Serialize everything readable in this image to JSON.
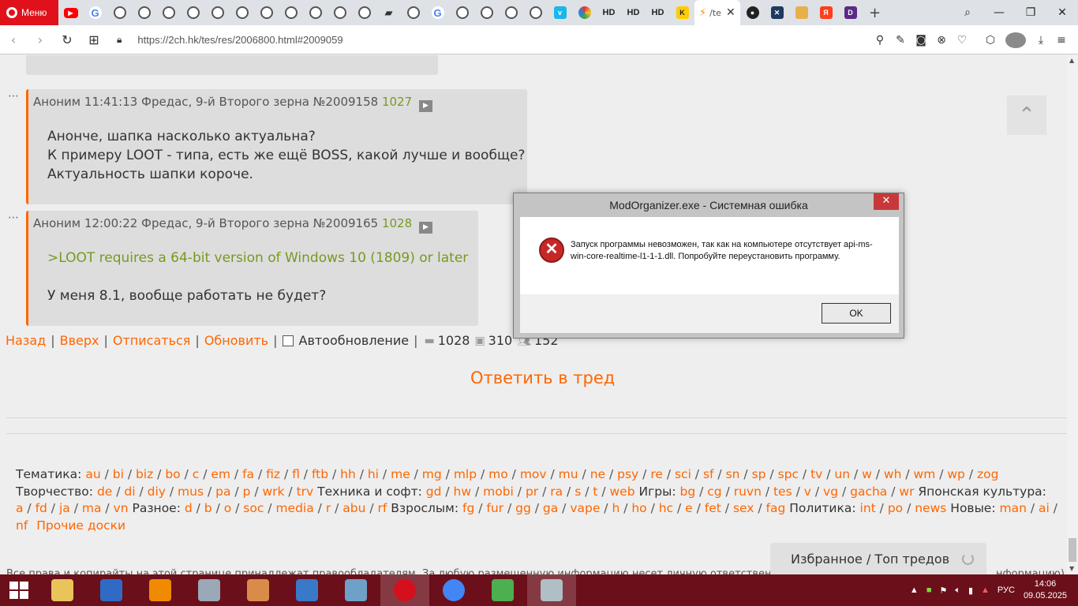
{
  "browser": {
    "menu_label": "Меню",
    "tab_icons": [
      "youtube-icon",
      "google-icon",
      "globe-icon",
      "globe-icon",
      "globe-icon",
      "globe-icon",
      "globe-icon",
      "globe-icon",
      "globe-icon",
      "globe-icon",
      "globe-icon",
      "globe-icon",
      "globe-icon",
      "car-icon",
      "globe-icon",
      "google-icon",
      "globe-icon",
      "globe-icon",
      "globe-icon",
      "globe-icon",
      "vimeo-icon",
      "colorful-icon",
      "hd-icon",
      "hd-icon",
      "hd-icon",
      "kg-icon"
    ],
    "hd_label": "HD",
    "active_tab_title": "/te",
    "url": "https://2ch.hk/tes/res/2006800.html#2009059"
  },
  "posts": [
    {
      "author": "Аноним",
      "time": "11:41:13 Фредас, 9-й Второго зерна",
      "id": "№2009158",
      "num": "1027",
      "lines": [
        "Анонче, шапка насколько актуальна?",
        "К примеру LOOT - типа, есть же ещё BOSS, какой лучше и вообще?",
        "Актуальность шапки короче."
      ]
    },
    {
      "author": "Аноним",
      "time": "12:00:22 Фредас, 9-й Второго зерна",
      "id": "№2009165",
      "num": "1028",
      "greentext": ">LOOT requires a 64-bit version of Windows 10 (1809) or later",
      "lines": [
        "У меня 8.1, вообще работать не будет?"
      ]
    }
  ],
  "thread_nav": {
    "back": "Назад",
    "up": "Вверх",
    "unsubscribe": "Отписаться",
    "refresh": "Обновить",
    "autoupdate": "Автообновление",
    "posts_count": "1028",
    "images_count": "310",
    "users_count": "152"
  },
  "reply_link": "Ответить в тред",
  "board_groups": [
    {
      "label": "Тематика:",
      "boards": [
        "au",
        "bi",
        "biz",
        "bo",
        "c",
        "em",
        "fa",
        "fiz",
        "fl",
        "ftb",
        "hh",
        "hi",
        "me",
        "mg",
        "mlp",
        "mo",
        "mov",
        "mu",
        "ne",
        "psy",
        "re",
        "sci",
        "sf",
        "sn",
        "sp",
        "spc",
        "tv",
        "un",
        "w",
        "wh",
        "wm",
        "wp",
        "zog"
      ]
    },
    {
      "label": "Творчество:",
      "boards": [
        "de",
        "di",
        "diy",
        "mus",
        "pa",
        "p",
        "wrk",
        "trv"
      ]
    },
    {
      "label": "Техника и софт:",
      "boards": [
        "gd",
        "hw",
        "mobi",
        "pr",
        "ra",
        "s",
        "t",
        "web"
      ]
    },
    {
      "label": "Игры:",
      "boards": [
        "bg",
        "cg",
        "ruvn",
        "tes",
        "v",
        "vg",
        "gacha",
        "wr"
      ]
    },
    {
      "label": "Японская культура:",
      "boards": [
        "a",
        "fd",
        "ja",
        "ma",
        "vn"
      ]
    },
    {
      "label": "Разное:",
      "boards": [
        "d",
        "b",
        "o",
        "soc",
        "media",
        "r",
        "abu",
        "rf"
      ]
    },
    {
      "label": "Взрослым:",
      "boards": [
        "fg",
        "fur",
        "gg",
        "ga",
        "vape",
        "h",
        "ho",
        "hc",
        "e",
        "fet",
        "sex",
        "fag"
      ]
    },
    {
      "label": "Политика:",
      "boards": [
        "int",
        "po",
        "news"
      ]
    },
    {
      "label": "Новые:",
      "boards": [
        "man",
        "ai",
        "nf"
      ]
    }
  ],
  "other_boards": "Прочие доски",
  "favorites": "Избранное / Топ тредов",
  "footer_text": "Все права и копирайты на этой странице принадлежат правообладателям. За любую размещенную информацию несет личную ответственность",
  "footer_text_tail": "нформацию)",
  "dialog": {
    "title": "ModOrganizer.exe - Системная ошибка",
    "message": "Запуск программы невозможен, так как на компьютере отсутствует api-ms-win-core-realtime-l1-1-1.dll. Попробуйте переустановить программу.",
    "ok": "OK",
    "close": "✕"
  },
  "taskbar": {
    "apps": [
      {
        "name": "file-explorer-icon",
        "color": "#e8c45a"
      },
      {
        "name": "control-panel-icon",
        "color": "#2f6bc4"
      },
      {
        "name": "vlc-icon",
        "color": "#f08a00"
      },
      {
        "name": "calculator-icon",
        "color": "#9aa8b8"
      },
      {
        "name": "paint-icon",
        "color": "#d98c4a"
      },
      {
        "name": "wordpad-icon",
        "color": "#3a78c8"
      },
      {
        "name": "notepad-icon",
        "color": "#6fa0c8"
      },
      {
        "name": "opera-icon",
        "color": "#d4101d"
      },
      {
        "name": "chrome-icon",
        "color": "#4285f4"
      },
      {
        "name": "spreadsheet-icon",
        "color": "#4caf50"
      },
      {
        "name": "window-app-icon",
        "color": "#b0bec5"
      }
    ],
    "language": "РУС",
    "time": "14:06",
    "date": "09.05.2025"
  }
}
